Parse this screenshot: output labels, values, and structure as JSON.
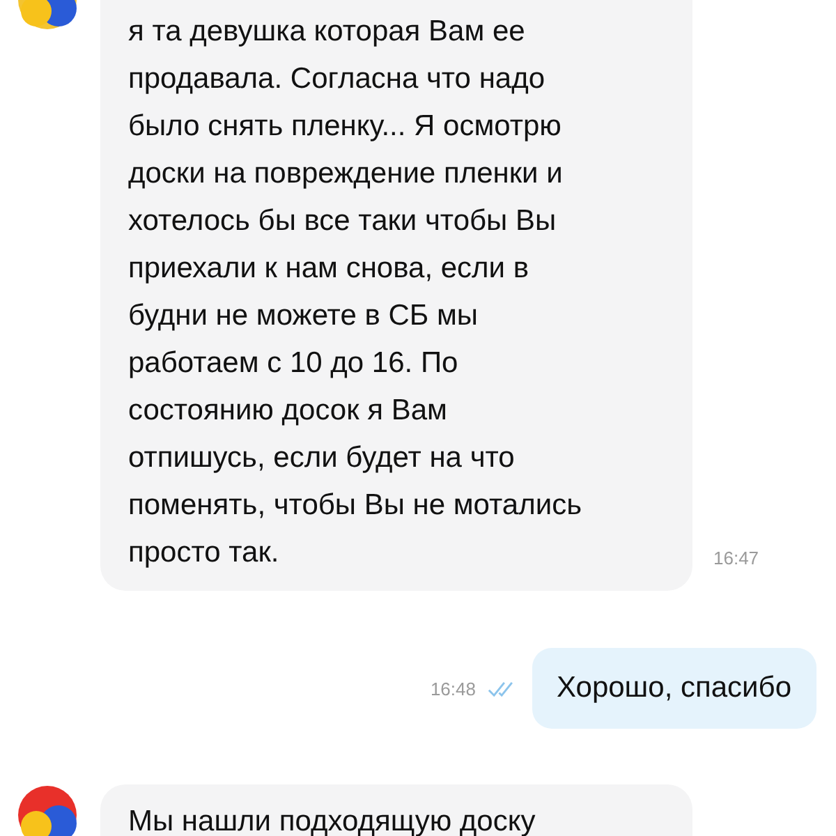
{
  "messages": [
    {
      "kind": "incoming",
      "avatar": true,
      "text": "я та девушка которая Вам ее\nпродавала. Согласна что надо\nбыло снять пленку... Я осмотрю\nдоски на повреждение пленки и\nхотелось бы все таки чтобы Вы\nприехали к нам снова, если в\nбудни не можете в СБ мы\nработаем с 10 до 16. По\nсостоянию досок я Вам\nотпишусь, если будет на что\nпоменять, чтобы Вы не мотались\nпросто так.",
      "time": "16:47"
    },
    {
      "kind": "outgoing",
      "text": "Хорошо, спасибо",
      "time": "16:48",
      "read": true
    },
    {
      "kind": "incoming",
      "avatar": true,
      "text": "Мы нашли подходящую доску"
    }
  ]
}
